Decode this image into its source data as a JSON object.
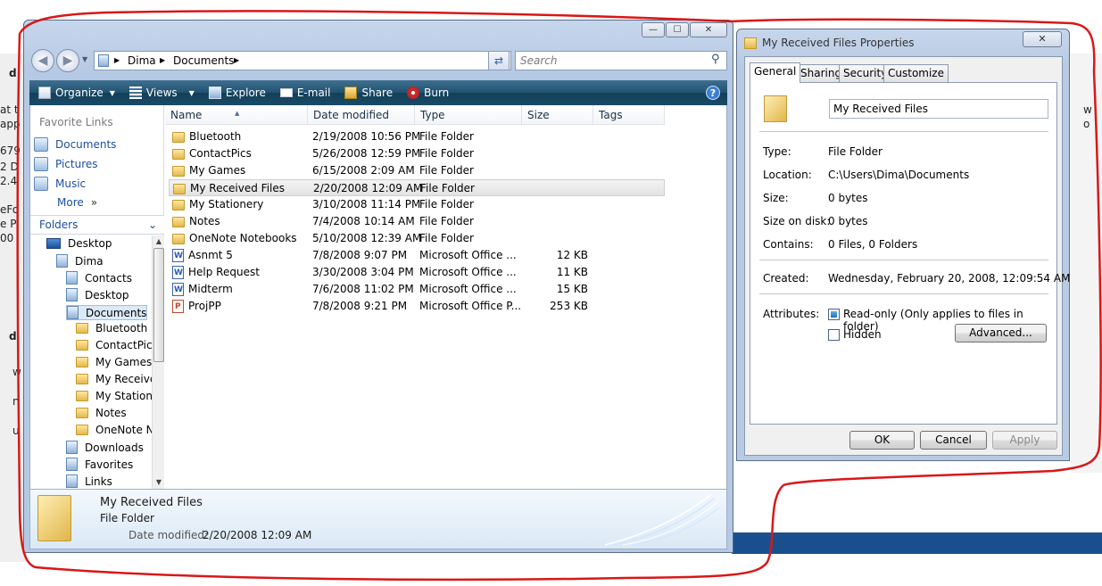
{
  "background": {
    "fragments": [
      "d",
      "at t",
      "app",
      "679",
      "2 D",
      "2.4",
      "eFo",
      "e P",
      "00",
      "d",
      "w",
      "n",
      "u"
    ],
    "right_fragments": [
      "w",
      "o"
    ]
  },
  "explorer": {
    "window_buttons": {
      "minimize": "—",
      "maximize": "☐",
      "close": "✕"
    },
    "breadcrumb": [
      "Dima",
      "Documents"
    ],
    "search_placeholder": "Search",
    "toolbar": {
      "organize": "Organize",
      "views": "Views",
      "explore": "Explore",
      "email": "E-mail",
      "share": "Share",
      "burn": "Burn"
    },
    "favorite_links_title": "Favorite Links",
    "favorite_links": [
      "Documents",
      "Pictures",
      "Music"
    ],
    "more_label": "More",
    "folders_label": "Folders",
    "tree": [
      {
        "label": "Desktop",
        "icon": "desktop-icon",
        "indent": 0
      },
      {
        "label": "Dima",
        "icon": "user-folder-icon",
        "indent": 1
      },
      {
        "label": "Contacts",
        "icon": "library-icon",
        "indent": 2
      },
      {
        "label": "Desktop",
        "icon": "library-icon",
        "indent": 2
      },
      {
        "label": "Documents",
        "icon": "library-icon",
        "indent": 2,
        "selected": true
      },
      {
        "label": "Bluetooth",
        "icon": "folder-icon",
        "indent": 3
      },
      {
        "label": "ContactPics",
        "icon": "folder-icon",
        "indent": 3
      },
      {
        "label": "My Games",
        "icon": "folder-icon",
        "indent": 3
      },
      {
        "label": "My Receive",
        "icon": "folder-icon",
        "indent": 3
      },
      {
        "label": "My Statione",
        "icon": "folder-icon",
        "indent": 3
      },
      {
        "label": "Notes",
        "icon": "folder-icon",
        "indent": 3
      },
      {
        "label": "OneNote N",
        "icon": "folder-icon",
        "indent": 3
      },
      {
        "label": "Downloads",
        "icon": "library-icon",
        "indent": 2
      },
      {
        "label": "Favorites",
        "icon": "library-icon",
        "indent": 2
      },
      {
        "label": "Links",
        "icon": "library-icon",
        "indent": 2
      }
    ],
    "columns": [
      "Name",
      "Date modified",
      "Type",
      "Size",
      "Tags"
    ],
    "files": [
      {
        "name": "Bluetooth",
        "date": "2/19/2008 10:56 PM",
        "type": "File Folder",
        "size": "",
        "icon": "folder"
      },
      {
        "name": "ContactPics",
        "date": "5/26/2008 12:59 PM",
        "type": "File Folder",
        "size": "",
        "icon": "folder"
      },
      {
        "name": "My Games",
        "date": "6/15/2008 2:09 AM",
        "type": "File Folder",
        "size": "",
        "icon": "folder"
      },
      {
        "name": "My Received Files",
        "date": "2/20/2008 12:09 AM",
        "type": "File Folder",
        "size": "",
        "icon": "folder",
        "selected": true
      },
      {
        "name": "My Stationery",
        "date": "3/10/2008 11:14 PM",
        "type": "File Folder",
        "size": "",
        "icon": "folder"
      },
      {
        "name": "Notes",
        "date": "7/4/2008 10:14 AM",
        "type": "File Folder",
        "size": "",
        "icon": "folder"
      },
      {
        "name": "OneNote Notebooks",
        "date": "5/10/2008 12:39 AM",
        "type": "File Folder",
        "size": "",
        "icon": "folder"
      },
      {
        "name": "Asnmt 5",
        "date": "7/8/2008 9:07 PM",
        "type": "Microsoft Office ...",
        "size": "12 KB",
        "icon": "word"
      },
      {
        "name": "Help Request",
        "date": "3/30/2008 3:04 PM",
        "type": "Microsoft Office ...",
        "size": "11 KB",
        "icon": "word"
      },
      {
        "name": "Midterm",
        "date": "7/6/2008 11:02 PM",
        "type": "Microsoft Office ...",
        "size": "15 KB",
        "icon": "word"
      },
      {
        "name": "ProjPP",
        "date": "7/8/2008 9:21 PM",
        "type": "Microsoft Office P...",
        "size": "253 KB",
        "icon": "ppt"
      }
    ],
    "details": {
      "name": "My Received Files",
      "type": "File Folder",
      "date_label": "Date modified:",
      "date": "2/20/2008 12:09 AM"
    }
  },
  "properties": {
    "title": "My Received Files Properties",
    "close": "✕",
    "tabs": [
      "General",
      "Sharing",
      "Security",
      "Customize"
    ],
    "name_value": "My Received Files",
    "rows": [
      {
        "label": "Type:",
        "value": "File Folder"
      },
      {
        "label": "Location:",
        "value": "C:\\Users\\Dima\\Documents"
      },
      {
        "label": "Size:",
        "value": "0 bytes"
      },
      {
        "label": "Size on disk:",
        "value": "0 bytes"
      },
      {
        "label": "Contains:",
        "value": "0 Files, 0 Folders"
      }
    ],
    "created_label": "Created:",
    "created_value": "Wednesday, February 20, 2008, 12:09:54 AM",
    "attributes_label": "Attributes:",
    "readonly_label": "Read-only (Only applies to files in folder)",
    "hidden_label": "Hidden",
    "advanced_label": "Advanced...",
    "ok_label": "OK",
    "cancel_label": "Cancel",
    "apply_label": "Apply"
  },
  "colors": {
    "annotation": "#d81818",
    "toolbar": "#1a4b66",
    "link": "#1c4fa0"
  }
}
